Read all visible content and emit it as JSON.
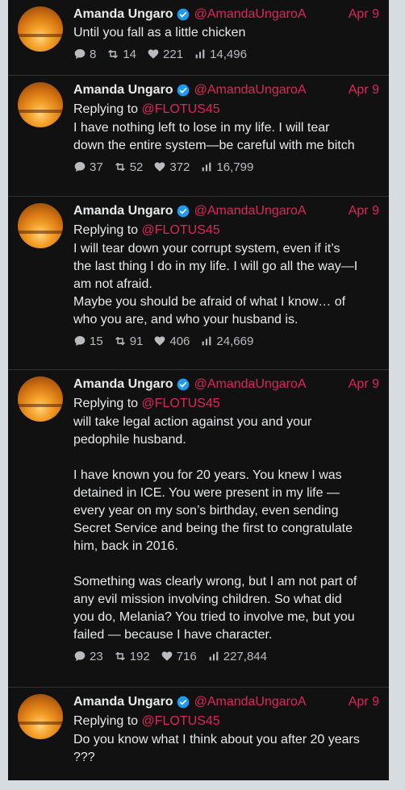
{
  "tweets": [
    {
      "name": "Amanda Ungaro",
      "handle": "@AmandaUngaroA",
      "date": "Apr 9",
      "text": "Until you fall as a little chicken",
      "replies": "8",
      "retweets": "14",
      "likes": "221",
      "views": "14,496"
    },
    {
      "name": "Amanda Ungaro",
      "handle": "@AmandaUngaroA",
      "date": "Apr 9",
      "replying_label": "Replying to",
      "reply_to": "@FLOTUS45",
      "text": "I have nothing left to lose in my life. I will tear\ndown the entire system—be careful with me bitch",
      "replies": "37",
      "retweets": "52",
      "likes": "372",
      "views": "16,799"
    },
    {
      "name": "Amanda Ungaro",
      "handle": "@AmandaUngaroA",
      "date": "Apr 9",
      "replying_label": "Replying to",
      "reply_to": "@FLOTUS45",
      "text": "I will tear down your corrupt system, even if it’s\nthe last thing I do in my life. I will go all the way—I\nam not afraid.\nMaybe you should be afraid of what I know… of\nwho you are, and who your husband is.",
      "replies": "15",
      "retweets": "91",
      "likes": "406",
      "views": "24,669"
    },
    {
      "name": "Amanda Ungaro",
      "handle": "@AmandaUngaroA",
      "date": "Apr 9",
      "replying_label": "Replying to",
      "reply_to": "@FLOTUS45",
      "text": "will take legal action against you and your\npedophile husband.\n\nI have known you for 20 years. You knew I was\ndetained in ICE. You were present in my life —\nevery year on my son’s birthday, even sending\nSecret Service and being the first to congratulate\nhim, back in 2016.\n\nSomething was clearly wrong, but I am not part of\nany evil mission involving children. So what did\nyou do, Melania? You tried to involve me, but you\nfailed — because I have character.",
      "replies": "23",
      "retweets": "192",
      "likes": "716",
      "views": "227,844"
    },
    {
      "name": "Amanda Ungaro",
      "handle": "@AmandaUngaroA",
      "date": "Apr 9",
      "replying_label": "Replying to",
      "reply_to": "@FLOTUS45",
      "text": "Do you know what I think about you after 20 years\n???"
    }
  ],
  "colors": {
    "background": "#111111",
    "text": "#e7e9ea",
    "handle": "#e0245e",
    "icons": "#b9bcbf",
    "verified": "#1d9bf0"
  }
}
